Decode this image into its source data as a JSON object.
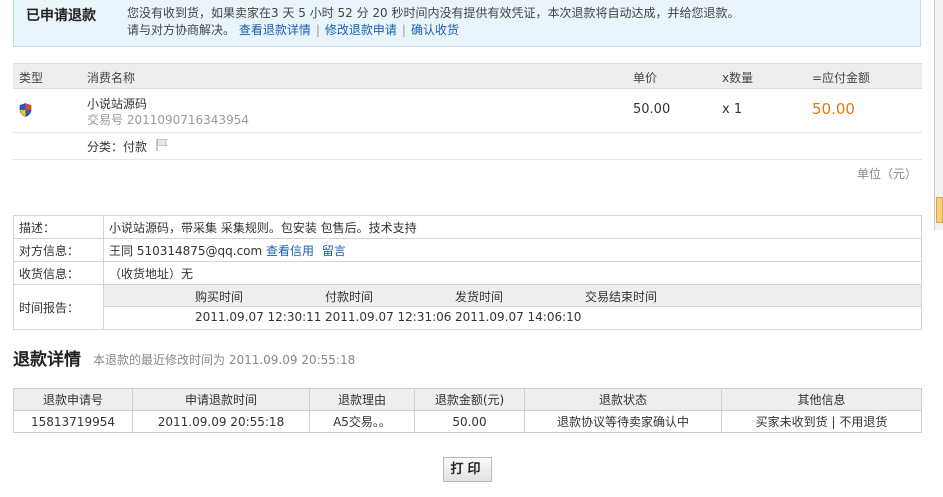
{
  "notice": {
    "title": "已申请退款",
    "line1": "您没有收到货，如果卖家在3 天  5 小时  52  分  20 秒时间内没有提供有效凭证，本次退款将自动达成，并给您退款。",
    "line2_prefix": "请与对方协商解决。",
    "links": [
      "查看退款详情",
      "修改退款申请",
      "确认收货"
    ]
  },
  "order": {
    "headers": [
      "类型",
      "消费名称",
      "单价",
      "x数量",
      "=应付金额"
    ],
    "item": {
      "name": "小说站源码",
      "trade_no": "交易号  2011090716343954",
      "price": "50.00",
      "qty": "x 1",
      "total": "50.00"
    },
    "category": "分类：付款",
    "unit": "单位（元）"
  },
  "info": {
    "desc_label": "描述：",
    "desc": "小说站源码，带采集 采集规则。包安装 包售后。技术支持",
    "party_label": "对方信息：",
    "party": "王同  510314875@qq.com",
    "party_links": [
      "查看信用",
      "留言"
    ],
    "address_label": "收货信息：",
    "address": "（收货地址）无",
    "time_label": "时间报告：",
    "time_headers": [
      "购买时间",
      "付款时间",
      "发货时间",
      "交易结束时间"
    ],
    "time_values": [
      "2011.09.07 12:30:11",
      "2011.09.07 12:31:06",
      "2011.09.07 14:06:10",
      ""
    ]
  },
  "refund": {
    "title": "退款详情",
    "subtitle": "本退款的最近修改时间为  2011.09.09 20:55:18",
    "headers": [
      "退款申请号",
      "申请退款时间",
      "退款理由",
      "退款金额(元)",
      "退款状态",
      "其他信息"
    ],
    "row": [
      "15813719954",
      "2011.09.09 20:55:18",
      "A5交易。。",
      "50.00",
      "退款协议等待卖家确认中",
      "买家未收到货  | 不用退货"
    ]
  },
  "print_label": "打印",
  "colors": {
    "accent": "#e07a10",
    "link": "#1a5fb4",
    "notice_bg": "#eaf4fb"
  }
}
